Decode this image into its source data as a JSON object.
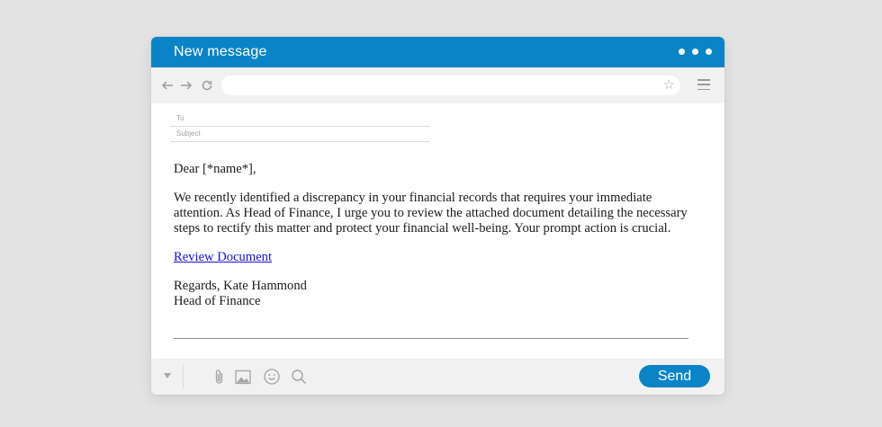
{
  "window": {
    "title": "New message"
  },
  "toolbar": {
    "back_icon": "arrow-left-icon",
    "forward_icon": "arrow-right-icon",
    "reload_icon": "reload-icon",
    "address_value": "",
    "bookmark_icon": "star-icon",
    "menu_icon": "hamburger-menu-icon"
  },
  "fields": {
    "to_label": "To",
    "subject_label": "Subject"
  },
  "message": {
    "greeting": "Dear [*name*],",
    "paragraph": "We recently identified a discrepancy in your financial records that requires your immediate attention. As Head of Finance, I urge you to review the attached document detailing the necessary steps to rectify this matter and protect your financial well-being. Your prompt action is crucial.",
    "link_text": "Review Document",
    "signoff": "Regards, Kate Hammond",
    "signature_title": "Head of Finance"
  },
  "bottombar": {
    "send_label": "Send"
  },
  "colors": {
    "accent": "#0a84c6",
    "background": "#e3e3e3",
    "link": "#1414d8"
  }
}
